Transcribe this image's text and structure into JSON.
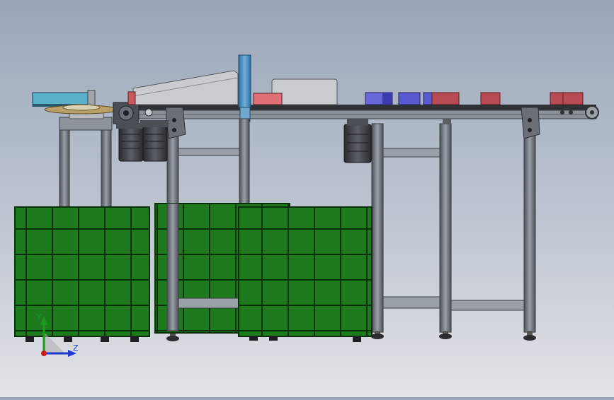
{
  "viewport": {
    "background_top": "#9aa6b8",
    "background_bottom": "#e2e4e8"
  },
  "colors": {
    "frame": "#5a5f66",
    "frame_light": "#8a9098",
    "pallet_green": "#1e7a1e",
    "pallet_grid": "#0c3a0c",
    "motor": "#3a3d42",
    "column_blue": "#4a8fc0",
    "box_red": "#c8585e",
    "box_blue": "#5a5ad0",
    "box_cyan": "#5ab0c8"
  },
  "triad": {
    "y_label": "Y",
    "z_label": "Z"
  }
}
